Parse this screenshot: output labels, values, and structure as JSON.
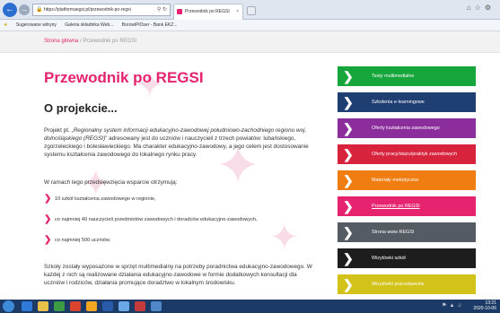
{
  "browser": {
    "url": "https://platformaegsi.pl/przewodnik-po-regsi",
    "tab_title": "Przewodnik po REGSI",
    "favorites": [
      "Sugerowane witryny",
      "Galeria składnika Web...",
      "BorowiPiOser - Bank EKZ..."
    ]
  },
  "breadcrumb": {
    "home": "Strona główna",
    "separator": "/",
    "current": "Przewodnik po REGSI"
  },
  "page": {
    "title": "Przewodnik po REGSI",
    "section_title": "O projekcie...",
    "intro_lead": "Projekt pt. „",
    "intro_italic": "Regionalny system informacji edukacyjno-zawodowej południowo-zachodniego regionu woj. dolnośląskiego (REGSI)",
    "intro_rest": "” adresowany jest do uczniów i nauczycieli z trzech powiatów: lubańskiego, zgorzeleckiego i bolesławieckiego. Ma charakter edukacyjno-zawodowy, a jego celem jest dostosowanie systemu kształcenia zawodowego do lokalnego rynku pracy.",
    "support_intro": "W ramach tego przedsięwzięcia wsparcie otrzymują:",
    "bullets": [
      "10 szkół kształcenia zawodowego w regionie,",
      "co najmniej 40 nauczycieli przedmiotów zawodowych i doradców edukacyjno-zawodowych,",
      "co najmniej 500 uczniów."
    ],
    "schools_paragraph": "Szkoły zostały wyposażone w sprzęt multimedialny na potrzeby poradnictwa edukacyjno-zawodowego. W każdej z nich są realizowane działania edukacyjno-zawodowe w formie dodatkowych konsultacji dla uczniów i rodziców, działania promujące doradztwo w lokalnym środowisku."
  },
  "menu": [
    {
      "label": "Testy multimedialne",
      "color": "#17a63c",
      "icon": "chevron-right-icon"
    },
    {
      "label": "Szkolenia e-learningowe",
      "color": "#1f3f73",
      "icon": "chevron-right-icon"
    },
    {
      "label": "Oferty kształcenia zawodowego",
      "color": "#8c2d9c",
      "icon": "chevron-right-icon"
    },
    {
      "label": "Oferty pracy/stażu/praktyk zawodowych",
      "color": "#d8233d",
      "icon": "chevron-right-icon"
    },
    {
      "label": "Materiały metodyczne",
      "color": "#f07d11",
      "icon": "chevron-right-icon"
    },
    {
      "label": "Przewodnik po REGSI",
      "color": "#e5236f",
      "icon": "chevron-right-icon",
      "active": true
    },
    {
      "label": "Strona www REGSI",
      "color": "#555b62",
      "icon": "chevron-right-icon"
    },
    {
      "label": "Wizytówki szkół",
      "color": "#1d1d1d",
      "icon": "chevron-right-icon"
    },
    {
      "label": "Wizytówki pracodawców",
      "color": "#d2c21a",
      "icon": "chevron-right-icon"
    }
  ],
  "taskbar": {
    "time": "13:21",
    "date": "2020-10-06"
  },
  "colors": {
    "accent": "#e5236f"
  }
}
